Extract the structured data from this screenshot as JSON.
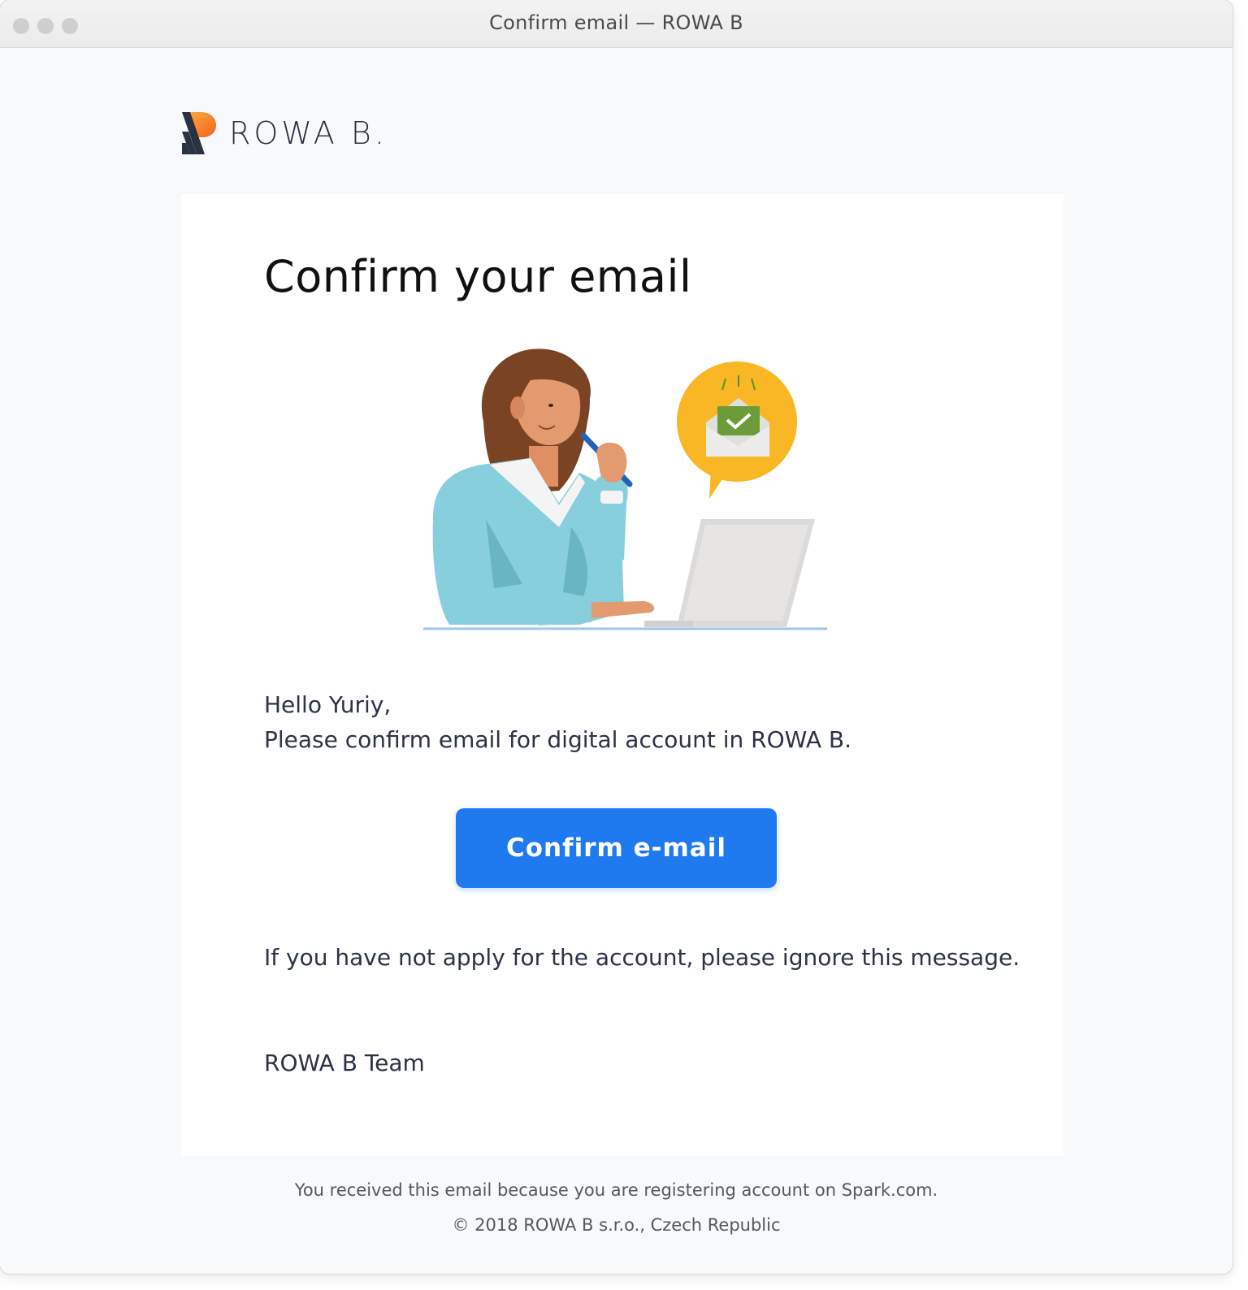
{
  "window": {
    "title": "Confirm email — ROWA B"
  },
  "brand": {
    "logo_text": "ROWA B.",
    "accent_orange": "#f5821f",
    "navy": "#2a3140"
  },
  "email": {
    "heading": "Confirm your email",
    "greeting": "Hello Yuriy,",
    "message": "Please confirm email for digital account in ROWA B.",
    "cta_label": "Confirm e-mail",
    "ignore_note": "If you have not apply for the account, please ignore this message.",
    "signature": "ROWA B Team"
  },
  "footer": {
    "reason": "You received this email because you are registering account on Spark.com.",
    "copyright": "© 2018 ROWA B s.r.o., Czech Republic"
  },
  "colors": {
    "button": "#1f7af0",
    "page_bg": "#f8f9fa",
    "card_bg": "#ffffff"
  },
  "icons": {
    "traffic_lights": [
      "close-dot",
      "minimize-dot",
      "zoom-dot"
    ],
    "illustration": "woman-laptop-email-confirmed-illustration"
  }
}
